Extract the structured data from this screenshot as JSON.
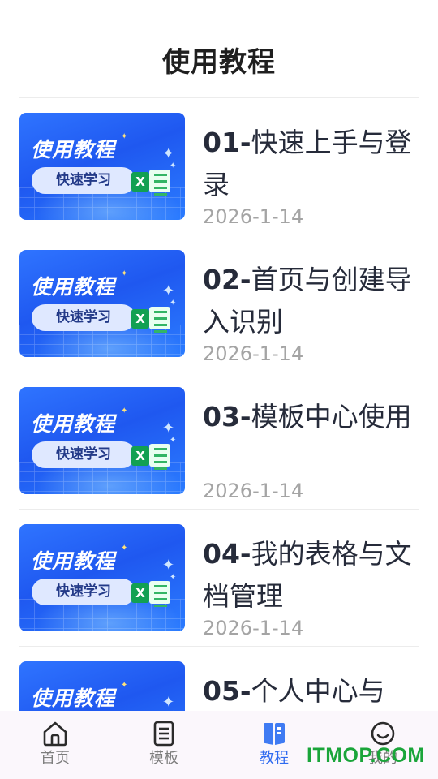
{
  "header": {
    "title": "使用教程"
  },
  "thumbnail": {
    "title": "使用教程",
    "tag": "快速学习",
    "excel_mark": "X"
  },
  "tutorials": [
    {
      "number": "01-",
      "title": "快速上手与登录",
      "date": "2026-1-14"
    },
    {
      "number": "02-",
      "title": "首页与创建导入识别",
      "date": "2026-1-14"
    },
    {
      "number": "03-",
      "title": "模板中心使用",
      "date": "2026-1-14"
    },
    {
      "number": "04-",
      "title": "我的表格与文档管理",
      "date": "2026-1-14"
    },
    {
      "number": "05-",
      "title": "个人中心与",
      "date": ""
    }
  ],
  "tabbar": {
    "items": [
      {
        "label": "首页",
        "icon": "home-icon",
        "active": false
      },
      {
        "label": "模板",
        "icon": "template-icon",
        "active": false
      },
      {
        "label": "教程",
        "icon": "book-icon",
        "active": true
      },
      {
        "label": "我的",
        "icon": "smile-icon",
        "active": false
      }
    ],
    "active_color": "#2f6bf0",
    "inactive_color": "#7d7d7d"
  },
  "watermark": "ITMOP.COM"
}
